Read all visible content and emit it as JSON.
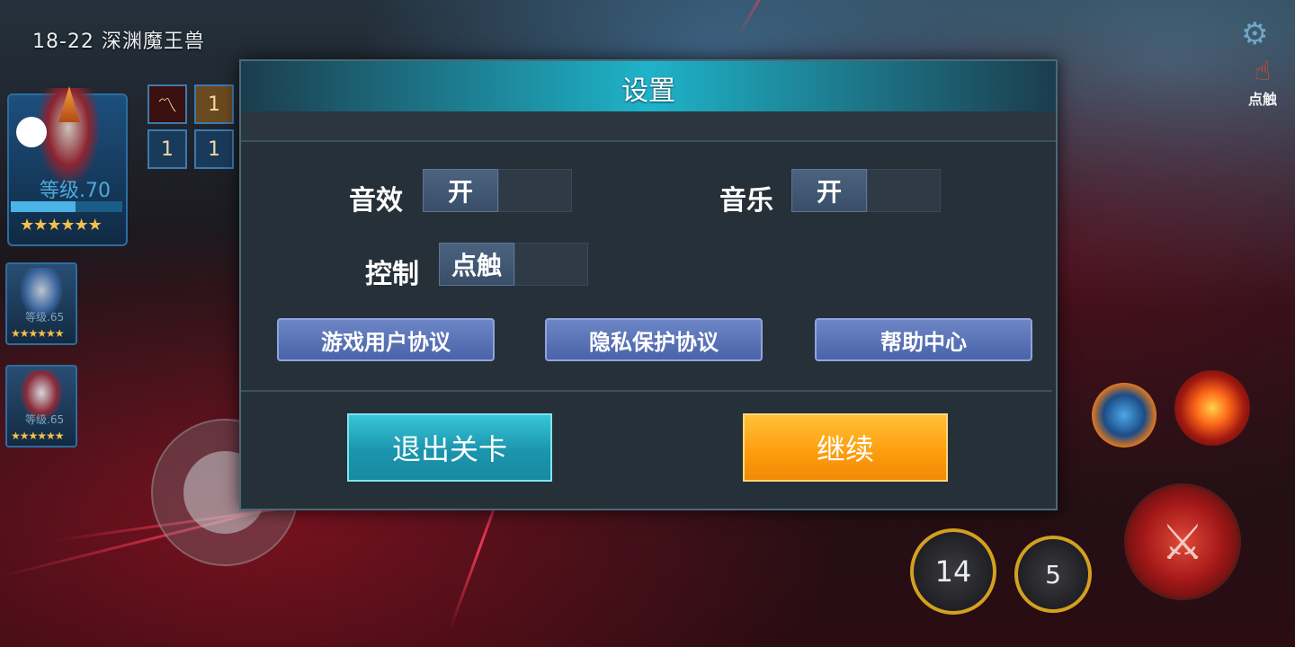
{
  "stage": {
    "title": "18-22 深渊魔王兽"
  },
  "hero": {
    "main_level": "等级.70",
    "exp_progress": 0.58,
    "stars": "★★★★★★",
    "small1_level": "等级.65",
    "small2_level": "等级.65",
    "small_stars": "★★★★★★",
    "skill_counts": [
      "1",
      "1",
      "1"
    ]
  },
  "hud": {
    "touch_label": "点触",
    "counter1": "14",
    "counter2": "5"
  },
  "settings": {
    "title": "设置",
    "sound_label": "音效",
    "sound_value": "开",
    "music_label": "音乐",
    "music_value": "开",
    "control_label": "控制",
    "control_value": "点触",
    "links": [
      "游戏用户协议",
      "隐私保护协议",
      "帮助中心"
    ],
    "exit_label": "退出关卡",
    "continue_label": "继续"
  },
  "colors": {
    "header_accent": "#1fb3c9",
    "exit_button": "#1b95ad",
    "continue_button": "#ff9e0f",
    "link_button": "#5a74b8"
  }
}
